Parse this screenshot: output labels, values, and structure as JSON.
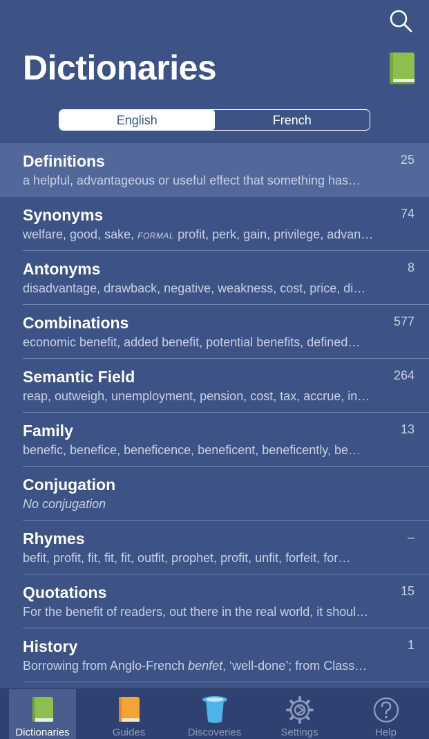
{
  "header": {
    "title": "Dictionaries",
    "search_icon": "search-icon",
    "book_icon": "green-book-icon"
  },
  "segmented": {
    "options": [
      "English",
      "French"
    ],
    "selected": "English"
  },
  "list": [
    {
      "title": "Definitions",
      "subtitle": "a helpful, advantageous or useful effect that something has…",
      "count": "25",
      "highlighted": true
    },
    {
      "title": "Synonyms",
      "subtitle_pre": "welfare, good, sake, ",
      "subtitle_tag": "FORMAL",
      "subtitle_post": " profit, perk, gain, privilege, advan…",
      "count": "74"
    },
    {
      "title": "Antonyms",
      "subtitle": "disadvantage, drawback, negative, weakness, cost, price, di…",
      "count": "8"
    },
    {
      "title": "Combinations",
      "subtitle": "economic benefit, added benefit, potential benefits, defined…",
      "count": "577"
    },
    {
      "title": "Semantic Field",
      "subtitle": "reap, outweigh, unemployment, pension, cost, tax, accrue, in…",
      "count": "264"
    },
    {
      "title": "Family",
      "subtitle": "benefic, benefice, beneficence, beneficent, beneficently, be…",
      "count": "13"
    },
    {
      "title": "Conjugation",
      "subtitle": "No conjugation",
      "count": ""
    },
    {
      "title": "Rhymes",
      "subtitle": "befit, profit, fit, fit, fit, outfit, prophet, profit, unfit, forfeit, for…",
      "count": "–"
    },
    {
      "title": "Quotations",
      "subtitle": "For the benefit of readers, out there in the real world, it shoul…",
      "count": "15"
    },
    {
      "title": "History",
      "subtitle_pre": "Borrowing from Anglo-French ",
      "subtitle_em": "benfet",
      "subtitle_post": ", ‘well-done’; from Class…",
      "count": "1"
    }
  ],
  "tabbar": [
    {
      "label": "Dictionaries",
      "icon": "green-book-icon",
      "active": true
    },
    {
      "label": "Guides",
      "icon": "orange-book-icon",
      "active": false
    },
    {
      "label": "Discoveries",
      "icon": "top-hat-icon",
      "active": false
    },
    {
      "label": "Settings",
      "icon": "gear-icon",
      "active": false
    },
    {
      "label": "Help",
      "icon": "question-mark-icon",
      "active": false
    }
  ],
  "colors": {
    "background": "#3d5285",
    "highlight_row": "#52679a",
    "tabbar": "#2f4170",
    "book_green": "#8cbf4f",
    "book_orange": "#f2a33a",
    "hat_blue": "#4fb3e8"
  }
}
